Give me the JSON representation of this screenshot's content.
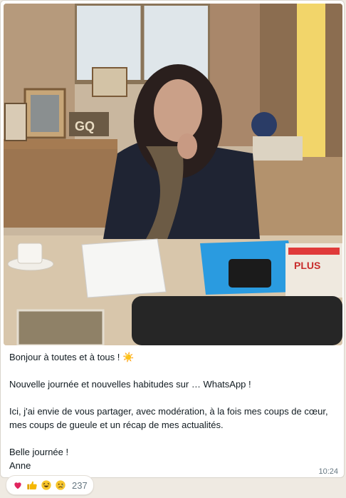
{
  "message": {
    "line1": "Bonjour à toutes et à tous ! ☀️",
    "line2": "Nouvelle journée et nouvelles habitudes sur … WhatsApp !",
    "line3": "Ici, j'ai envie de vous partager, avec modération, à la fois mes coups de cœur, mes coups de gueule et un récap de mes actualités.",
    "line4": "Belle journée !",
    "line5": "Anne",
    "time": "10:24"
  },
  "photo": {
    "magazine_label": "GQ",
    "newspaper_label": "PLUS"
  },
  "reactions": {
    "icons": [
      "heart-icon",
      "thumbs-up-icon",
      "laughing-face-icon",
      "crying-face-icon"
    ],
    "count": "237"
  },
  "colors": {
    "chat_background": "#efeae2",
    "bubble": "#ffffff",
    "text": "#111b21",
    "meta": "#667781"
  }
}
